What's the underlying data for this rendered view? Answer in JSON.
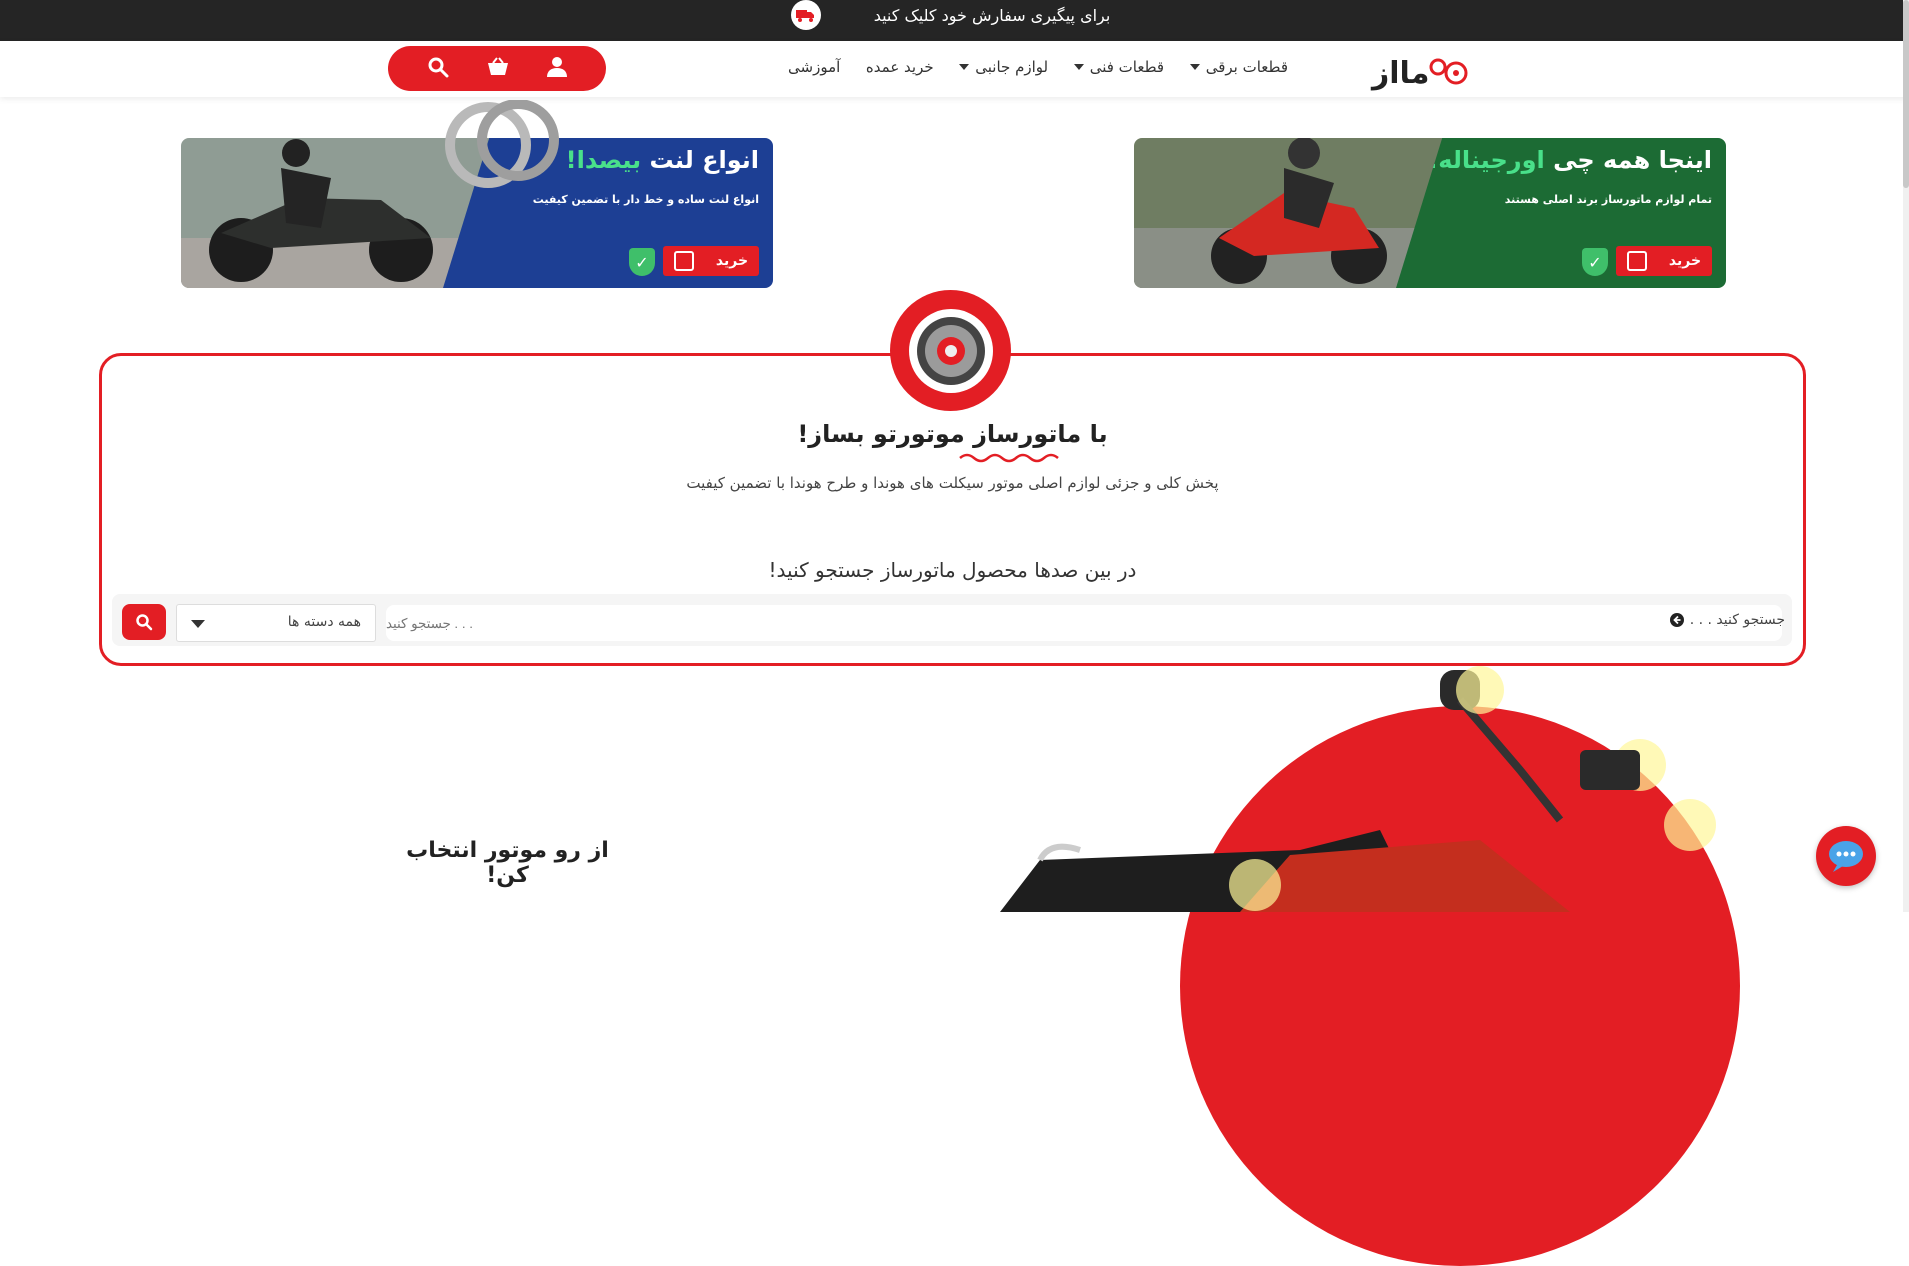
{
  "topbar": {
    "track_text": "برای پیگیری سفارش خود کلیک کنید",
    "truck_icon": "truck-icon"
  },
  "brand": {
    "logo_text": "ماتوراز",
    "accent": "#e31e24"
  },
  "nav": {
    "items": [
      {
        "label": "قطعات برقی",
        "has_dropdown": true
      },
      {
        "label": "قطعات فنی",
        "has_dropdown": true
      },
      {
        "label": "لوازم جانبی",
        "has_dropdown": true
      },
      {
        "label": "خرید عمده",
        "has_dropdown": false
      },
      {
        "label": "آموزشی",
        "has_dropdown": false
      }
    ]
  },
  "header_actions": {
    "icons": [
      "user-icon",
      "basket-icon",
      "search-icon"
    ]
  },
  "banners": {
    "right": {
      "title_part1": "اینجا همه چی",
      "title_highlight": "اورجیناله!",
      "subtitle": "تمام لوازم ماتورساز برند اصلی هستند",
      "buy_label": "خرید",
      "panel_color": "#1c6b34"
    },
    "left": {
      "title_part1": "انواع لنت",
      "title_highlight": "بیصدا!",
      "subtitle": "انواع لنت ساده و خط دار با تضمین کیفیت",
      "buy_label": "خرید",
      "panel_color": "#1d3f94"
    }
  },
  "hero": {
    "heading_part1": "با",
    "heading_accent": "ماتورساز",
    "heading_part2": "موتورتو بساز!",
    "subtitle": "پخش کلی و جزئی لوازم اصلی موتور سیکلت های هوندا و طرح هوندا با تضمین کیفیت"
  },
  "search": {
    "title": "در بین صدها محصول ماتورساز جستجو کنید!",
    "placeholder": "جستجو کنید . . .",
    "category_selected": "همه دسته ها"
  },
  "moto_section": {
    "title": "از رو موتور انتخاب کن!",
    "circle_color": "#e31e24"
  },
  "chat": {
    "icon": "chat-icon"
  }
}
